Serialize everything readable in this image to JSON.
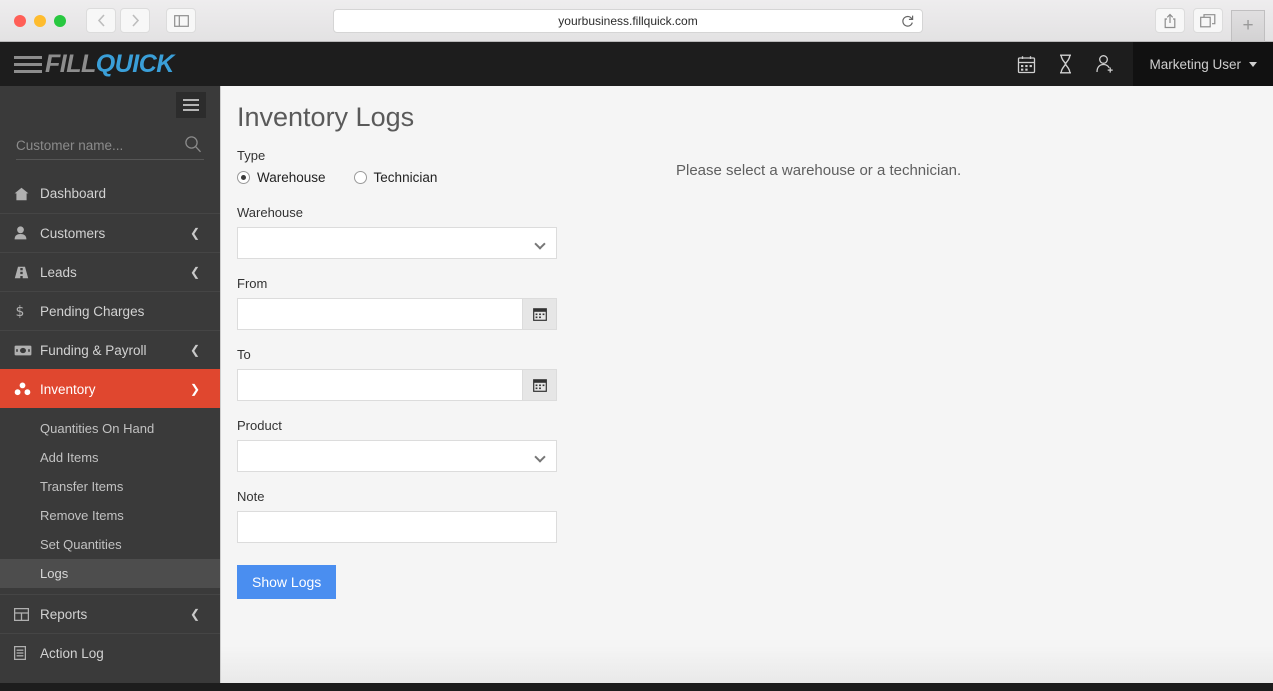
{
  "browser": {
    "url": "yourbusiness.fillquick.com",
    "back_label": "Back",
    "forward_label": "Forward",
    "sidebar_toggle_label": "Show Sidebar",
    "reload_label": "Reload",
    "share_label": "Share",
    "tabs_overview_label": "Tab Overview",
    "new_tab_label": "+"
  },
  "header": {
    "logo_fill": "FILL",
    "logo_quick": "QUICK",
    "icons": [
      "calendar-icon",
      "hourglass-icon",
      "add-user-icon"
    ],
    "user": "Marketing User"
  },
  "sidebar": {
    "search_placeholder": "Customer name...",
    "items": [
      {
        "label": "Dashboard",
        "icon": "home-icon",
        "expandable": false,
        "active": false
      },
      {
        "label": "Customers",
        "icon": "user-icon",
        "expandable": true,
        "active": false
      },
      {
        "label": "Leads",
        "icon": "road-icon",
        "expandable": true,
        "active": false
      },
      {
        "label": "Pending Charges",
        "icon": "dollar-icon",
        "expandable": false,
        "active": false
      },
      {
        "label": "Funding & Payroll",
        "icon": "money-bill-icon",
        "expandable": true,
        "active": false
      },
      {
        "label": "Inventory",
        "icon": "cubes-icon",
        "expandable": true,
        "active": true
      }
    ],
    "inventory_sub": [
      {
        "label": "Quantities On Hand",
        "active": false
      },
      {
        "label": "Add Items",
        "active": false
      },
      {
        "label": "Transfer Items",
        "active": false
      },
      {
        "label": "Remove Items",
        "active": false
      },
      {
        "label": "Set Quantities",
        "active": false
      },
      {
        "label": "Logs",
        "active": true
      }
    ],
    "items_after": [
      {
        "label": "Reports",
        "icon": "table-icon",
        "expandable": true,
        "active": false
      },
      {
        "label": "Action Log",
        "icon": "list-icon",
        "expandable": false,
        "active": false
      }
    ]
  },
  "main": {
    "title": "Inventory Logs",
    "type_label": "Type",
    "radio_warehouse": "Warehouse",
    "radio_technician": "Technician",
    "warehouse_label": "Warehouse",
    "warehouse_value": "",
    "from_label": "From",
    "from_value": "",
    "to_label": "To",
    "to_value": "",
    "product_label": "Product",
    "product_value": "",
    "note_label": "Note",
    "note_value": "",
    "submit_label": "Show Logs",
    "empty_message": "Please select a warehouse or a technician."
  },
  "colors": {
    "accent_red": "#e0472f",
    "accent_blue": "#4a8ef0",
    "logo_blue": "#3a9fd8",
    "header_dark": "#1d1d1d",
    "sidebar_dark": "#3a3a3a"
  }
}
